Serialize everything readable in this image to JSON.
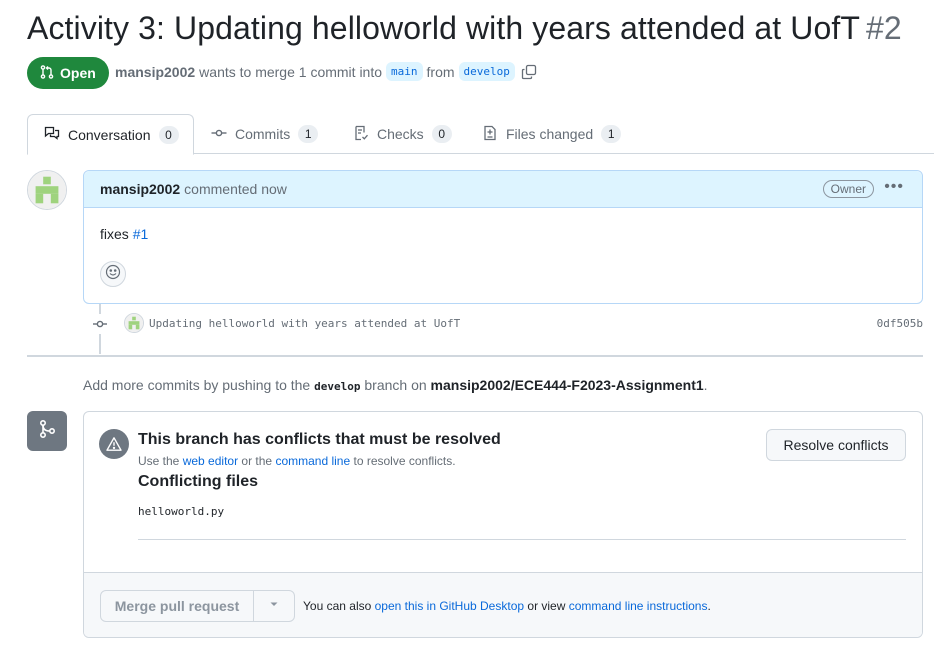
{
  "pr": {
    "title": "Activity 3: Updating helloworld with years attended at UofT",
    "number": "#2",
    "state": "Open",
    "author": "mansip2002",
    "meta_mid": "wants to merge 1 commit into",
    "base_branch": "main",
    "meta_from": "from",
    "head_branch": "develop"
  },
  "tabs": [
    {
      "label": "Conversation",
      "count": "0"
    },
    {
      "label": "Commits",
      "count": "1"
    },
    {
      "label": "Checks",
      "count": "0"
    },
    {
      "label": "Files changed",
      "count": "1"
    }
  ],
  "comment": {
    "author": "mansip2002",
    "action": "commented now",
    "badge": "Owner",
    "menu": "•••",
    "body_text": "fixes",
    "body_link": "#1"
  },
  "commit": {
    "message": "Updating helloworld with years attended at UofT",
    "sha": "0df505b"
  },
  "push_hint": {
    "prefix": "Add more commits by pushing to the",
    "branch": "develop",
    "middle": "branch on",
    "repo": "mansip2002/ECE444-F2023-Assignment1",
    "suffix": "."
  },
  "merge": {
    "conflict_title": "This branch has conflicts that must be resolved",
    "desc_1": "Use the",
    "desc_link_1": "web editor",
    "desc_2": "or the",
    "desc_link_2": "command line",
    "desc_3": "to resolve conflicts.",
    "resolve_label": "Resolve conflicts",
    "files_title": "Conflicting files",
    "files": [
      "helloworld.py"
    ],
    "merge_label": "Merge pull request",
    "foot_1": "You can also",
    "foot_link_1": "open this in GitHub Desktop",
    "foot_2": "or view",
    "foot_link_2": "command line instructions",
    "foot_3": "."
  },
  "colors": {
    "open_green": "#1f883d",
    "link_blue": "#0969da",
    "comment_header_bg": "#ddf4ff",
    "neutral_icon": "#6e7781"
  }
}
